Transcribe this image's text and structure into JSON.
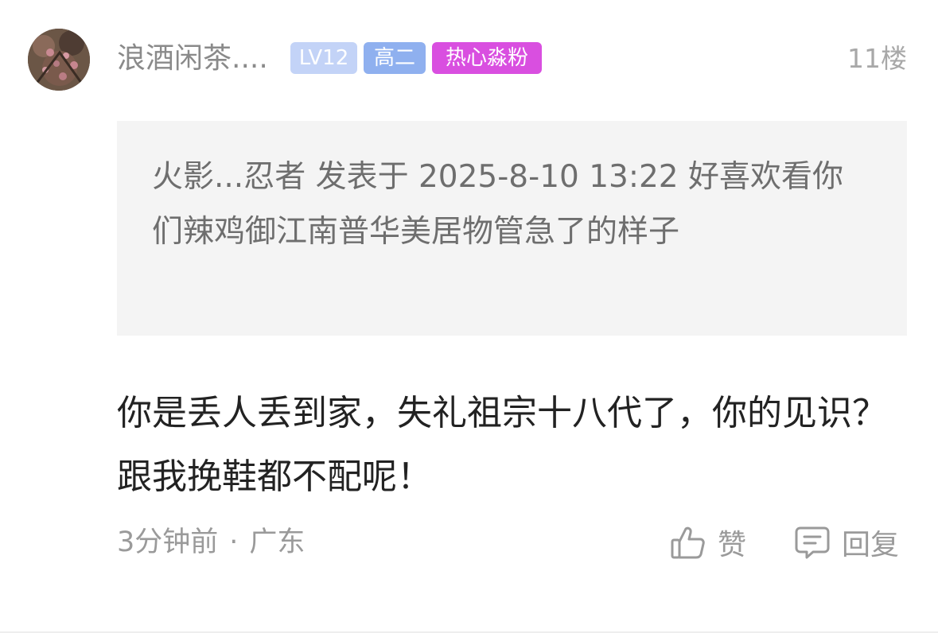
{
  "comment": {
    "username": "浪酒闲茶....",
    "badges": {
      "level": "LV12",
      "grade": "高二",
      "fan": "热心淼粉"
    },
    "floor": "11楼",
    "quote": "火影...忍者 发表于 2025-8-10 13:22 好喜欢看你们辣鸡御江南普华美居物管急了的样子",
    "body": "你是丢人丢到家，失礼祖宗十八代了，你的见识？跟我挽鞋都不配呢！",
    "time": "3分钟前",
    "separator": "·",
    "location": "广东",
    "like_label": "赞",
    "reply_label": "回复"
  },
  "icons": {
    "avatar": "avatar-photo",
    "like": "thumbs-up-icon",
    "reply": "comment-icon"
  },
  "colors": {
    "badge_level": "#c3d3f7",
    "badge_grade": "#8fb0ef",
    "badge_fan": "#d94fe0",
    "quote_background": "#f4f4f4",
    "meta_text": "#9a9a9a"
  }
}
